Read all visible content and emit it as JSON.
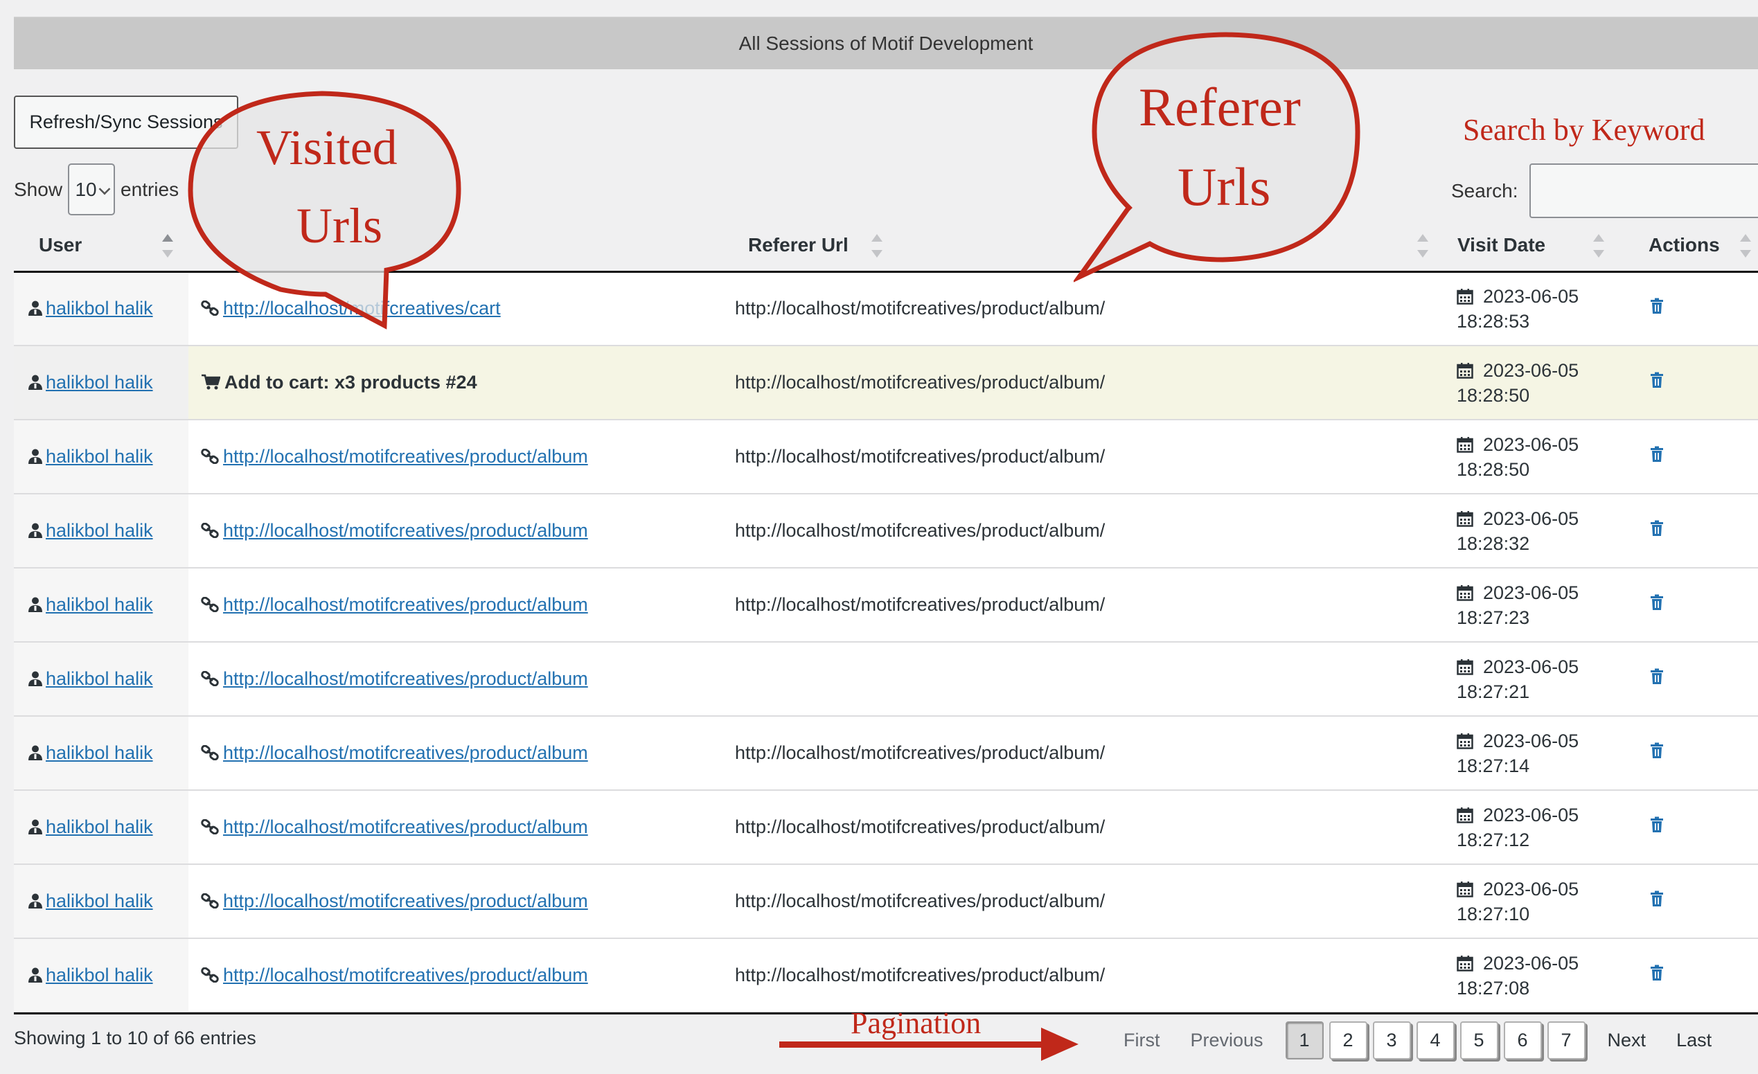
{
  "page": {
    "title": "All Sessions of Motif Development",
    "sync_button": "Refresh/Sync Sessions",
    "show_label": "Show",
    "entries_value": "10",
    "entries_label": "entries",
    "search_label": "Search:",
    "search_value": ""
  },
  "table": {
    "headers": {
      "user": "User",
      "visited": "",
      "referer": "Referer Url",
      "visit_date": "Visit Date",
      "actions": "Actions"
    },
    "rows": [
      {
        "user": "halikbol halik",
        "visited": "http://localhost/motifcreatives/cart",
        "visited_type": "link",
        "referer": "http://localhost/motifcreatives/product/album/",
        "date": "2023-06-05",
        "time": "18:28:53"
      },
      {
        "user": "halikbol halik",
        "visited": "Add to cart: x3 products #24",
        "visited_type": "cart",
        "referer": "http://localhost/motifcreatives/product/album/",
        "date": "2023-06-05",
        "time": "18:28:50"
      },
      {
        "user": "halikbol halik",
        "visited": "http://localhost/motifcreatives/product/album",
        "visited_type": "link",
        "referer": "http://localhost/motifcreatives/product/album/",
        "date": "2023-06-05",
        "time": "18:28:50"
      },
      {
        "user": "halikbol halik",
        "visited": "http://localhost/motifcreatives/product/album",
        "visited_type": "link",
        "referer": "http://localhost/motifcreatives/product/album/",
        "date": "2023-06-05",
        "time": "18:28:32"
      },
      {
        "user": "halikbol halik",
        "visited": "http://localhost/motifcreatives/product/album",
        "visited_type": "link",
        "referer": "http://localhost/motifcreatives/product/album/",
        "date": "2023-06-05",
        "time": "18:27:23"
      },
      {
        "user": "halikbol halik",
        "visited": "http://localhost/motifcreatives/product/album",
        "visited_type": "link",
        "referer": "",
        "date": "2023-06-05",
        "time": "18:27:21"
      },
      {
        "user": "halikbol halik",
        "visited": "http://localhost/motifcreatives/product/album",
        "visited_type": "link",
        "referer": "http://localhost/motifcreatives/product/album/",
        "date": "2023-06-05",
        "time": "18:27:14"
      },
      {
        "user": "halikbol halik",
        "visited": "http://localhost/motifcreatives/product/album",
        "visited_type": "link",
        "referer": "http://localhost/motifcreatives/product/album/",
        "date": "2023-06-05",
        "time": "18:27:12"
      },
      {
        "user": "halikbol halik",
        "visited": "http://localhost/motifcreatives/product/album",
        "visited_type": "link",
        "referer": "http://localhost/motifcreatives/product/album/",
        "date": "2023-06-05",
        "time": "18:27:10"
      },
      {
        "user": "halikbol halik",
        "visited": "http://localhost/motifcreatives/product/album",
        "visited_type": "link",
        "referer": "http://localhost/motifcreatives/product/album/",
        "date": "2023-06-05",
        "time": "18:27:08"
      }
    ]
  },
  "footer": {
    "info": "Showing 1 to 10 of 66 entries",
    "first": "First",
    "previous": "Previous",
    "pages": [
      "1",
      "2",
      "3",
      "4",
      "5",
      "6",
      "7"
    ],
    "current_page": "1",
    "next": "Next",
    "last": "Last"
  },
  "annotations": {
    "visited_line1": "Visited",
    "visited_line2": "Urls",
    "referer_line1": "Referer",
    "referer_line2": "Urls",
    "search_note": "Search by Keyword",
    "pagination_note": "Pagination"
  },
  "colors": {
    "link": "#2271b1",
    "annotation": "#c0281a",
    "highlight_row": "#f5f5e4",
    "header_bar": "#c8c8c8"
  }
}
